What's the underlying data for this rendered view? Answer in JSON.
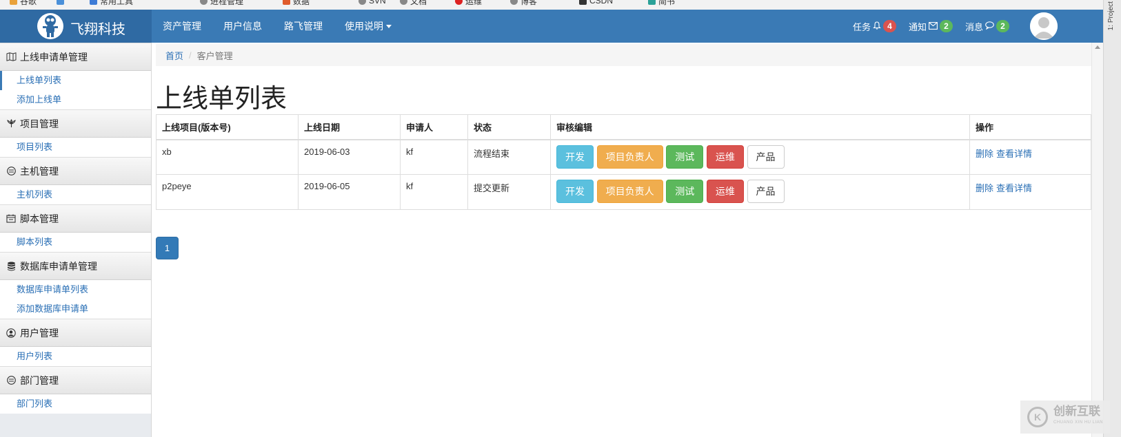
{
  "bookmarks": [
    "谷歌",
    "常用工具",
    "进程管理",
    "数据",
    "SVN",
    "文档",
    "运维",
    "博客",
    "CSDN",
    "简书"
  ],
  "navbar": {
    "brand": "飞翔科技",
    "links": [
      "资产管理",
      "用户信息",
      "路飞管理"
    ],
    "dropdown": "使用说明",
    "tasks": {
      "label": "任务",
      "count": "4",
      "color": "#d9534f"
    },
    "notices": {
      "label": "通知",
      "count": "2",
      "color": "#5cb85c"
    },
    "messages": {
      "label": "消息",
      "count": "2",
      "color": "#5cb85c"
    }
  },
  "ide_strip": "1: Project",
  "sidebar": [
    {
      "title": "上线申请单管理",
      "icon": "map-icon",
      "items": [
        "上线单列表",
        "添加上线单"
      ]
    },
    {
      "title": "项目管理",
      "icon": "flower-icon",
      "items": [
        "项目列表"
      ]
    },
    {
      "title": "主机管理",
      "icon": "host-icon",
      "items": [
        "主机列表"
      ]
    },
    {
      "title": "脚本管理",
      "icon": "calendar-icon",
      "items": [
        "脚本列表"
      ]
    },
    {
      "title": "数据库申请单管理",
      "icon": "database-icon",
      "items": [
        "数据库申请单列表",
        "添加数据库申请单"
      ]
    },
    {
      "title": "用户管理",
      "icon": "user-icon",
      "items": [
        "用户列表"
      ]
    },
    {
      "title": "部门管理",
      "icon": "department-icon",
      "items": [
        "部门列表"
      ]
    }
  ],
  "breadcrumb": {
    "home": "首页",
    "current": "客户管理"
  },
  "page_title": "上线单列表",
  "table": {
    "headers": [
      "上线项目(版本号)",
      "上线日期",
      "申请人",
      "状态",
      "审核编辑",
      "操作"
    ],
    "rows": [
      {
        "project": "xb",
        "date": "2019-06-03",
        "applicant": "kf",
        "status": "流程结束"
      },
      {
        "project": "p2peye",
        "date": "2019-06-05",
        "applicant": "kf",
        "status": "提交更新"
      }
    ],
    "review_buttons": [
      "开发",
      "项目负责人",
      "测试",
      "运维",
      "产品"
    ],
    "ops": {
      "delete": "删除",
      "detail": "查看详情"
    }
  },
  "pagination": {
    "current": "1"
  },
  "watermark": {
    "text": "创新互联",
    "sub": "CHUANG XIN HU LIAN"
  }
}
